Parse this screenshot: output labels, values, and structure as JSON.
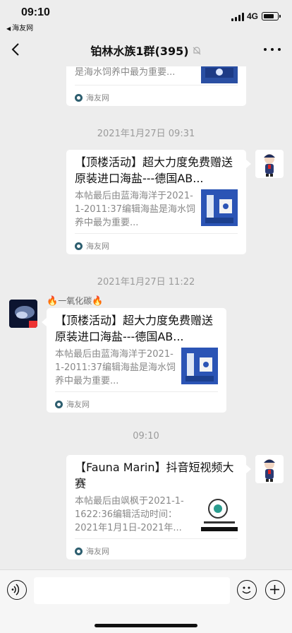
{
  "status_bar": {
    "time": "09:10",
    "back_app": "海友网",
    "network": "4G"
  },
  "header": {
    "title": "铂林水族1群(395)"
  },
  "messages": [
    {
      "desc": "是海水饲养中最为重要...",
      "source": "海友网"
    },
    {
      "timestamp": "2021年1月27日 09:31",
      "title": "【顶楼活动】超大力度免费赠送原装进口海盐---德国AB...",
      "desc": "本帖最后由蓝海海洋于2021-1-2011:37编辑海盐是海水饲养中最为重要...",
      "source": "海友网"
    },
    {
      "timestamp": "2021年1月27日 11:22",
      "sender": "一氧化碳",
      "title": "【顶楼活动】超大力度免费赠送原装进口海盐---德国AB...",
      "desc": "本帖最后由蓝海海洋于2021-1-2011:37编辑海盐是海水饲养中最为重要...",
      "source": "海友网"
    },
    {
      "timestamp": "09:10",
      "title": "【Fauna Marin】抖音短视频大赛",
      "desc": "本帖最后由飒枫于2021-1-1622:36编辑活动时间：2021年1月1日-2021年...",
      "source": "海友网"
    }
  ],
  "icons": {
    "back": "chevron-left-icon",
    "mute": "bell-slash-icon",
    "more": "more-dots-icon",
    "voice": "voice-icon",
    "emoji": "emoji-icon",
    "plus": "plus-icon"
  }
}
